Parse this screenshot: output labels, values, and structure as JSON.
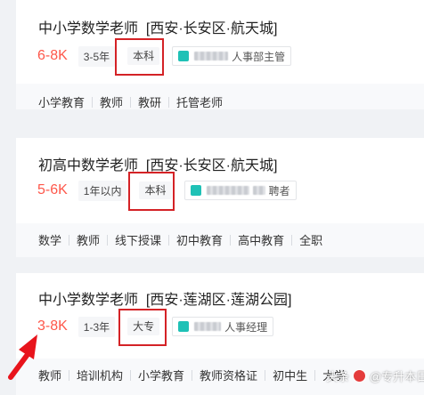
{
  "jobs": [
    {
      "title": "中小学数学老师",
      "location": "[西安·长安区·航天城]",
      "salary": "6-8K",
      "experience": "3-5年",
      "education": "本科",
      "recruiter_role": "人事部主管",
      "skills": [
        "小学教育",
        "教师",
        "教研",
        "托管老师"
      ]
    },
    {
      "title": "初高中数学老师",
      "location": "[西安·长安区·航天城]",
      "salary": "5-6K",
      "experience": "1年以内",
      "education": "本科",
      "recruiter_role": "聘者",
      "skills": [
        "数学",
        "教师",
        "线下授课",
        "初中教育",
        "高中教育",
        "全职"
      ]
    },
    {
      "title": "中小学数学老师",
      "location": "[西安·莲湖区·莲湖公园]",
      "salary": "3-8K",
      "experience": "1-3年",
      "education": "大专",
      "recruiter_role": "人事经理",
      "skills": [
        "教师",
        "培训机构",
        "小学教育",
        "教师资格证",
        "初中生",
        "大学"
      ]
    }
  ],
  "watermark": {
    "prefix": "头条",
    "account": "@专升本日记"
  },
  "colors": {
    "salary": "#fe574a",
    "highlight_box": "#d42226",
    "annotation_arrow": "#e8141c",
    "recruiter_icon": "#1fc1b6"
  }
}
